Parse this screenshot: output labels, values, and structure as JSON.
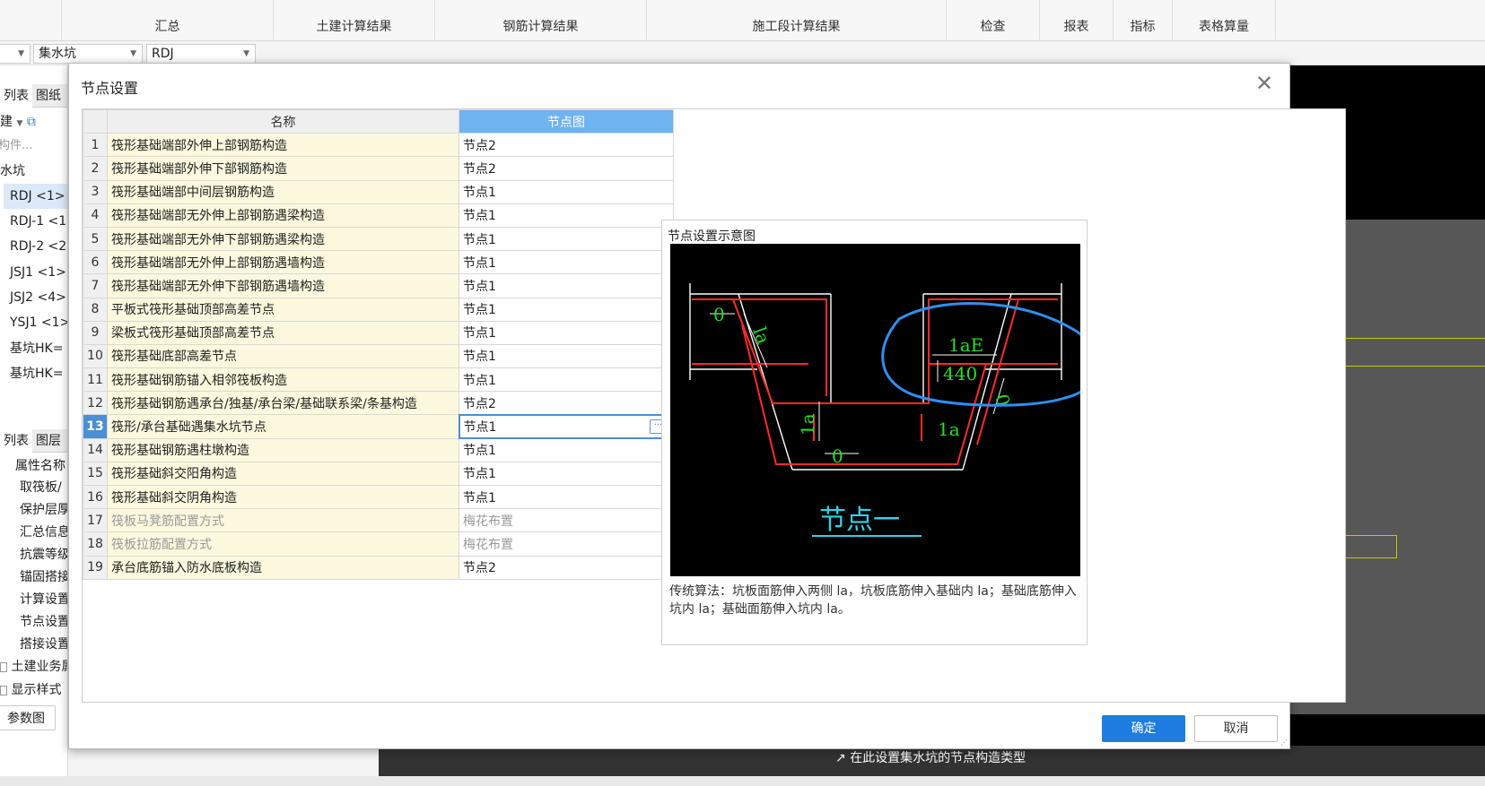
{
  "ribbon": {
    "tabs": [
      "汇总",
      "土建计算结果",
      "钢筋计算结果",
      "施工段计算结果",
      "检查",
      "报表",
      "指标",
      "表格算量"
    ]
  },
  "toolbar2": {
    "combo1": "集水坑",
    "combo2": "RDJ"
  },
  "left_panel": {
    "tab_list": "列表",
    "tab_drawing": "图纸",
    "new_label": "建",
    "search_placeholder": "构件...",
    "group": "水坑",
    "items": [
      "RDJ <1>",
      "RDJ-1 <1>",
      "RDJ-2 <2>",
      "JSJ1 <1>",
      "JSJ2 <4>",
      "YSJ1 <1>",
      "基坑HK=",
      "基坑HK="
    ],
    "tab_list2": "列表",
    "tab_layer": "图层",
    "prop_header": "属性名称",
    "props": [
      "取筏板/",
      "保护层厚",
      "汇总信息",
      "抗震等级",
      "锚固搭接",
      "计算设置",
      "节点设置",
      "搭接设置"
    ],
    "check1": "土建业务属性",
    "check2": "显示样式",
    "param_btn": "参数图"
  },
  "dialog": {
    "title": "节点设置",
    "col_name": "名称",
    "col_node": "节点图",
    "rows": [
      {
        "num": "1",
        "name": "筏形基础端部外伸上部钢筋构造",
        "value": "节点2"
      },
      {
        "num": "2",
        "name": "筏形基础端部外伸下部钢筋构造",
        "value": "节点2"
      },
      {
        "num": "3",
        "name": "筏形基础端部中间层钢筋构造",
        "value": "节点1"
      },
      {
        "num": "4",
        "name": "筏形基础端部无外伸上部钢筋遇梁构造",
        "value": "节点1"
      },
      {
        "num": "5",
        "name": "筏形基础端部无外伸下部钢筋遇梁构造",
        "value": "节点1"
      },
      {
        "num": "6",
        "name": "筏形基础端部无外伸上部钢筋遇墙构造",
        "value": "节点1"
      },
      {
        "num": "7",
        "name": "筏形基础端部无外伸下部钢筋遇墙构造",
        "value": "节点1"
      },
      {
        "num": "8",
        "name": "平板式筏形基础顶部高差节点",
        "value": "节点1"
      },
      {
        "num": "9",
        "name": "梁板式筏形基础顶部高差节点",
        "value": "节点1"
      },
      {
        "num": "10",
        "name": "筏形基础底部高差节点",
        "value": "节点1"
      },
      {
        "num": "11",
        "name": "筏形基础钢筋锚入相邻筏板构造",
        "value": "节点1"
      },
      {
        "num": "12",
        "name": "筏形基础钢筋遇承台/独基/承台梁/基础联系梁/条基构造",
        "value": "节点2"
      },
      {
        "num": "13",
        "name": "筏形/承台基础遇集水坑节点",
        "value": "节点1"
      },
      {
        "num": "14",
        "name": "筏形基础钢筋遇柱墩构造",
        "value": "节点1"
      },
      {
        "num": "15",
        "name": "筏形基础斜交阳角构造",
        "value": "节点1"
      },
      {
        "num": "16",
        "name": "筏形基础斜交阴角构造",
        "value": "节点1"
      },
      {
        "num": "17",
        "name": "筏板马凳筋配置方式",
        "value": "梅花布置"
      },
      {
        "num": "18",
        "name": "筏板拉筋配置方式",
        "value": "梅花布置"
      },
      {
        "num": "19",
        "name": "承台底筋锚入防水底板构造",
        "value": "节点2"
      }
    ],
    "preview_title": "节点设置示意图",
    "diagram_caption": "节点一",
    "diagram_labels": {
      "zero_top": "0",
      "la_slope": "la",
      "lae": "1aE",
      "dim_440": "440",
      "zero_right": "0",
      "la_left": "1a",
      "la_right": "1a",
      "zero_bottom": "0"
    },
    "preview_desc": "传统算法：坑板面筋伸入两侧 la，坑板底筋伸入基础内 la；基础底筋伸入坑内 la；基础面筋伸入坑内 la。",
    "ok_label": "确定",
    "cancel_label": "取消"
  },
  "status_hint": "在此设置集水坑的节点构造类型",
  "colors": {
    "accent": "#1f7ce0",
    "header_selected": "#6fb3f1",
    "name_cell_bg": "#fbf8dd"
  }
}
